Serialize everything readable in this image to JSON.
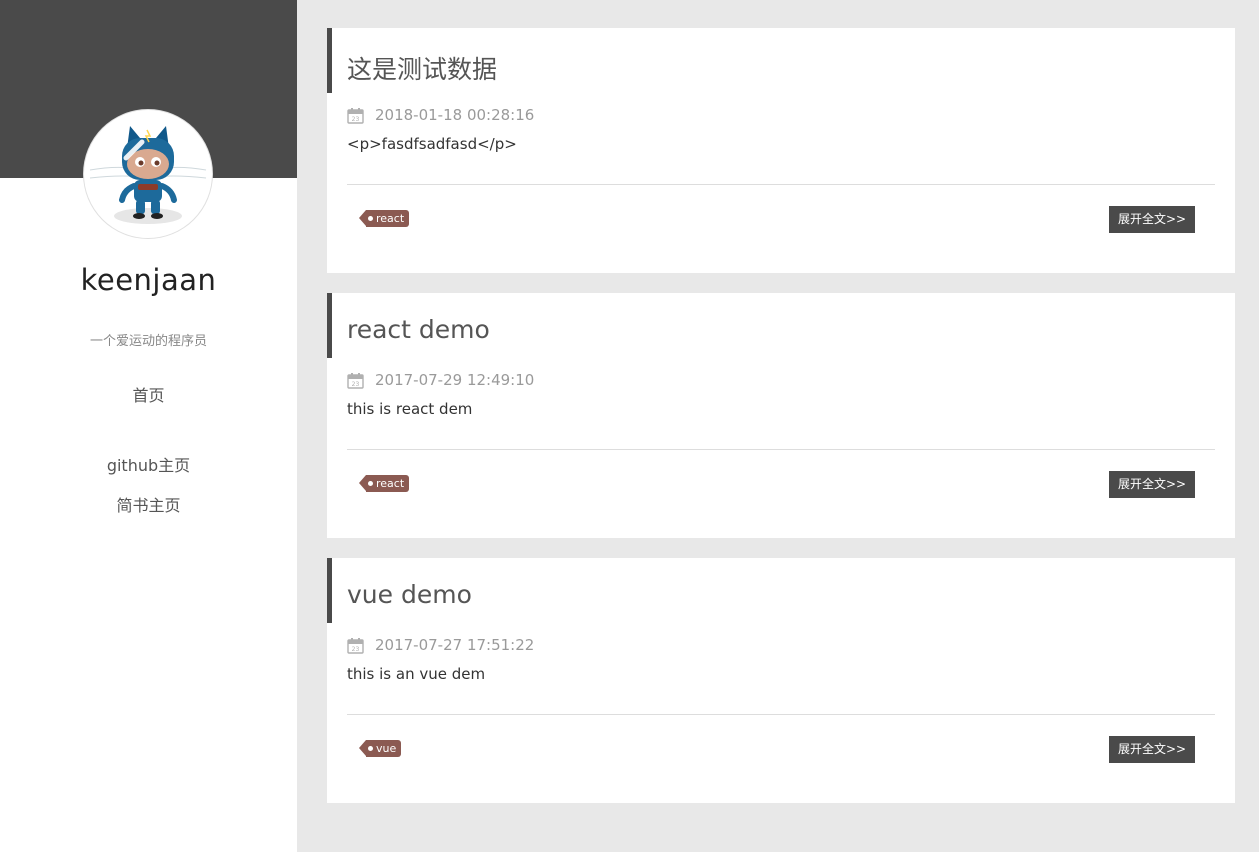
{
  "sidebar": {
    "author_name": "keenjaan",
    "bio": "一个爱运动的程序员",
    "nav": {
      "home": "首页",
      "github": "github主页",
      "jianshu": "简书主页"
    }
  },
  "posts": [
    {
      "title": "这是测试数据",
      "date": "2018-01-18 00:28:16",
      "excerpt": "<p>fasdfsadfasd</p>",
      "tag": "react",
      "read_more": "展开全文>>"
    },
    {
      "title": "react demo",
      "date": "2017-07-29 12:49:10",
      "excerpt": "this is react dem",
      "tag": "react",
      "read_more": "展开全文>>"
    },
    {
      "title": "vue demo",
      "date": "2017-07-27 17:51:22",
      "excerpt": "this is an vue dem",
      "tag": "vue",
      "read_more": "展开全文>>"
    }
  ],
  "colors": {
    "banner": "#4a4a4a",
    "background": "#e8e8e8",
    "tag": "#8b5a52",
    "button": "#4a4a4a"
  },
  "icons": {
    "avatar": "octocat-avatar",
    "date": "calendar-icon"
  }
}
